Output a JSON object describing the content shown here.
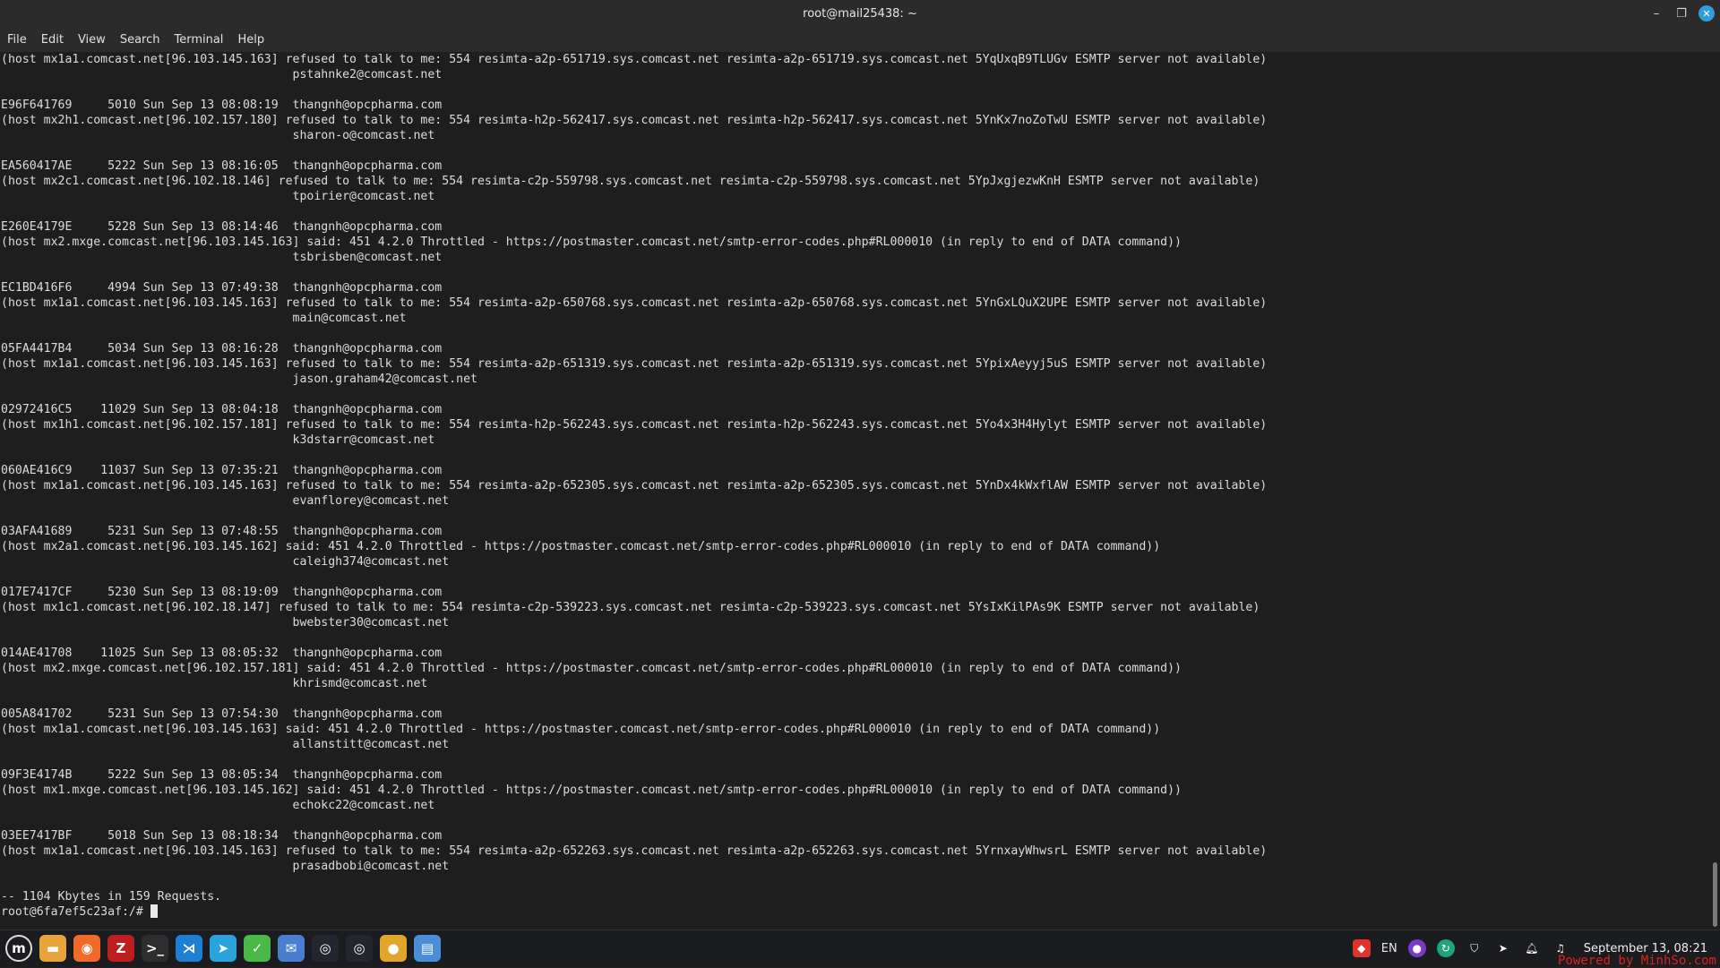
{
  "window": {
    "title": "root@mail25438: ~",
    "controls": [
      "–",
      "❐",
      "✕"
    ]
  },
  "menu": [
    "File",
    "Edit",
    "View",
    "Search",
    "Terminal",
    "Help"
  ],
  "terminal_lines": [
    "(host mx1a1.comcast.net[96.103.145.163] refused to talk to me: 554 resimta-a2p-651719.sys.comcast.net resimta-a2p-651719.sys.comcast.net 5YqUxqB9TLUGv ESMTP server not available)",
    "                                         pstahnke2@comcast.net",
    "",
    "E96F641769     5010 Sun Sep 13 08:08:19  thangnh@opcpharma.com",
    "(host mx2h1.comcast.net[96.102.157.180] refused to talk to me: 554 resimta-h2p-562417.sys.comcast.net resimta-h2p-562417.sys.comcast.net 5YnKx7noZoTwU ESMTP server not available)",
    "                                         sharon-o@comcast.net",
    "",
    "EA560417AE     5222 Sun Sep 13 08:16:05  thangnh@opcpharma.com",
    "(host mx2c1.comcast.net[96.102.18.146] refused to talk to me: 554 resimta-c2p-559798.sys.comcast.net resimta-c2p-559798.sys.comcast.net 5YpJxgjezwKnH ESMTP server not available)",
    "                                         tpoirier@comcast.net",
    "",
    "E260E4179E     5228 Sun Sep 13 08:14:46  thangnh@opcpharma.com",
    "(host mx2.mxge.comcast.net[96.103.145.163] said: 451 4.2.0 Throttled - https://postmaster.comcast.net/smtp-error-codes.php#RL000010 (in reply to end of DATA command))",
    "                                         tsbrisben@comcast.net",
    "",
    "EC1BD416F6     4994 Sun Sep 13 07:49:38  thangnh@opcpharma.com",
    "(host mx1a1.comcast.net[96.103.145.163] refused to talk to me: 554 resimta-a2p-650768.sys.comcast.net resimta-a2p-650768.sys.comcast.net 5YnGxLQuX2UPE ESMTP server not available)",
    "                                         main@comcast.net",
    "",
    "05FA4417B4     5034 Sun Sep 13 08:16:28  thangnh@opcpharma.com",
    "(host mx1a1.comcast.net[96.103.145.163] refused to talk to me: 554 resimta-a2p-651319.sys.comcast.net resimta-a2p-651319.sys.comcast.net 5YpixAeyyj5uS ESMTP server not available)",
    "                                         jason.graham42@comcast.net",
    "",
    "02972416C5    11029 Sun Sep 13 08:04:18  thangnh@opcpharma.com",
    "(host mx1h1.comcast.net[96.102.157.181] refused to talk to me: 554 resimta-h2p-562243.sys.comcast.net resimta-h2p-562243.sys.comcast.net 5Yo4x3H4Hylyt ESMTP server not available)",
    "                                         k3dstarr@comcast.net",
    "",
    "060AE416C9    11037 Sun Sep 13 07:35:21  thangnh@opcpharma.com",
    "(host mx1a1.comcast.net[96.103.145.163] refused to talk to me: 554 resimta-a2p-652305.sys.comcast.net resimta-a2p-652305.sys.comcast.net 5YnDx4kWxflAW ESMTP server not available)",
    "                                         evanflorey@comcast.net",
    "",
    "03AFA41689     5231 Sun Sep 13 07:48:55  thangnh@opcpharma.com",
    "(host mx2a1.comcast.net[96.103.145.162] said: 451 4.2.0 Throttled - https://postmaster.comcast.net/smtp-error-codes.php#RL000010 (in reply to end of DATA command))",
    "                                         caleigh374@comcast.net",
    "",
    "017E7417CF     5230 Sun Sep 13 08:19:09  thangnh@opcpharma.com",
    "(host mx1c1.comcast.net[96.102.18.147] refused to talk to me: 554 resimta-c2p-539223.sys.comcast.net resimta-c2p-539223.sys.comcast.net 5YsIxKilPAs9K ESMTP server not available)",
    "                                         bwebster30@comcast.net",
    "",
    "014AE41708    11025 Sun Sep 13 08:05:32  thangnh@opcpharma.com",
    "(host mx2.mxge.comcast.net[96.102.157.181] said: 451 4.2.0 Throttled - https://postmaster.comcast.net/smtp-error-codes.php#RL000010 (in reply to end of DATA command))",
    "                                         khrismd@comcast.net",
    "",
    "005A841702     5231 Sun Sep 13 07:54:30  thangnh@opcpharma.com",
    "(host mx1a1.comcast.net[96.103.145.163] said: 451 4.2.0 Throttled - https://postmaster.comcast.net/smtp-error-codes.php#RL000010 (in reply to end of DATA command))",
    "                                         allanstitt@comcast.net",
    "",
    "09F3E4174B     5222 Sun Sep 13 08:05:34  thangnh@opcpharma.com",
    "(host mx1.mxge.comcast.net[96.103.145.162] said: 451 4.2.0 Throttled - https://postmaster.comcast.net/smtp-error-codes.php#RL000010 (in reply to end of DATA command))",
    "                                         echokc22@comcast.net",
    "",
    "03EE7417BF     5018 Sun Sep 13 08:18:34  thangnh@opcpharma.com",
    "(host mx1a1.comcast.net[96.103.145.163] refused to talk to me: 554 resimta-a2p-652263.sys.comcast.net resimta-a2p-652263.sys.comcast.net 5YrnxayWhwsrL ESMTP server not available)",
    "                                         prasadbobi@comcast.net",
    "",
    "-- 1104 Kbytes in 159 Requests."
  ],
  "prompt": "root@6fa7ef5c23af:/# ",
  "taskbar": {
    "apps": [
      {
        "name": "mint-menu-icon",
        "glyph": "m",
        "color": "#1b1c1f"
      },
      {
        "name": "files-icon",
        "glyph": "▬",
        "color": "#e8a33a"
      },
      {
        "name": "firefox-icon",
        "glyph": "◉",
        "color": "#f06a2a"
      },
      {
        "name": "filezilla-icon",
        "glyph": "Z",
        "color": "#bf1e1e"
      },
      {
        "name": "terminal-icon",
        "glyph": ">_",
        "color": "#2d2d2d"
      },
      {
        "name": "vscode-icon",
        "glyph": "⋊",
        "color": "#1f7fd4"
      },
      {
        "name": "telegram-icon",
        "glyph": "➤",
        "color": "#2aa3dc"
      },
      {
        "name": "app-green-icon",
        "glyph": "✓",
        "color": "#4bb84a"
      },
      {
        "name": "mail-icon",
        "glyph": "✉",
        "color": "#4a7fd0"
      },
      {
        "name": "app-dark1-icon",
        "glyph": "◎",
        "color": "#22262e"
      },
      {
        "name": "app-dark2-icon",
        "glyph": "◎",
        "color": "#22262e"
      },
      {
        "name": "chrome-icon",
        "glyph": "●",
        "color": "#e2a52b"
      },
      {
        "name": "remote-desktop-icon",
        "glyph": "▤",
        "color": "#4a8fd6"
      }
    ],
    "tray": {
      "lang": "EN",
      "clock": "September 13, 08:21"
    }
  },
  "watermark": "Powered by MinhSo.com",
  "colors": {
    "background": "#1e1e1e",
    "text": "#dcdcdc",
    "taskbar": "#1b1c1f"
  }
}
